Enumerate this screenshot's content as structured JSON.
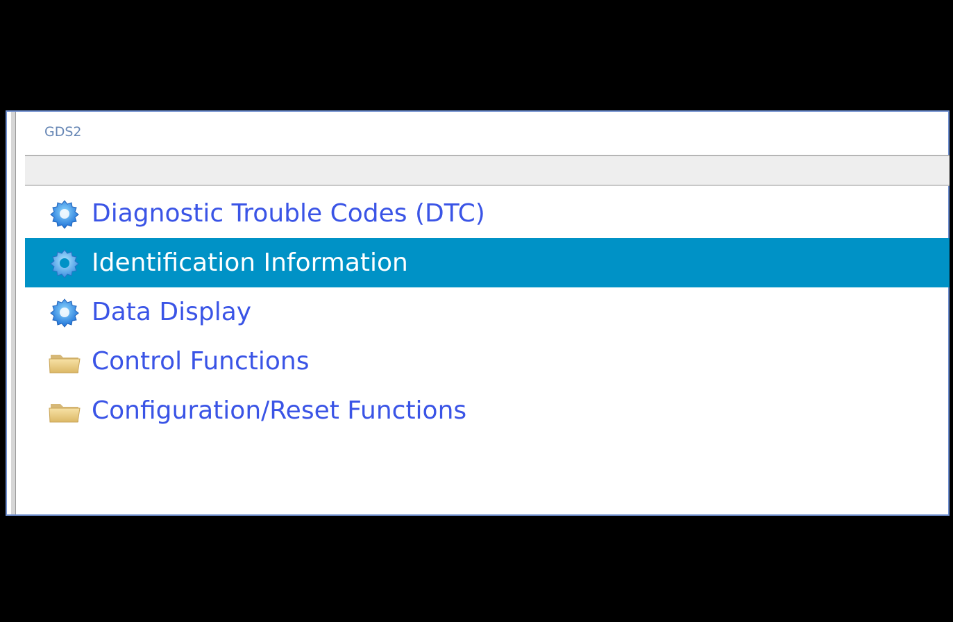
{
  "window": {
    "title": "GDS2"
  },
  "menu": {
    "items": [
      {
        "label": "Diagnostic Trouble Codes (DTC)",
        "icon": "gear-icon",
        "selected": false
      },
      {
        "label": "Identification Information",
        "icon": "gear-icon",
        "selected": true
      },
      {
        "label": "Data Display",
        "icon": "gear-icon",
        "selected": false
      },
      {
        "label": "Control Functions",
        "icon": "folder-icon",
        "selected": false
      },
      {
        "label": "Configuration/Reset Functions",
        "icon": "folder-icon",
        "selected": false
      }
    ]
  },
  "colors": {
    "accent_selected": "#0092c6",
    "link_text": "#3a54e6",
    "title_text": "#6787b5"
  }
}
